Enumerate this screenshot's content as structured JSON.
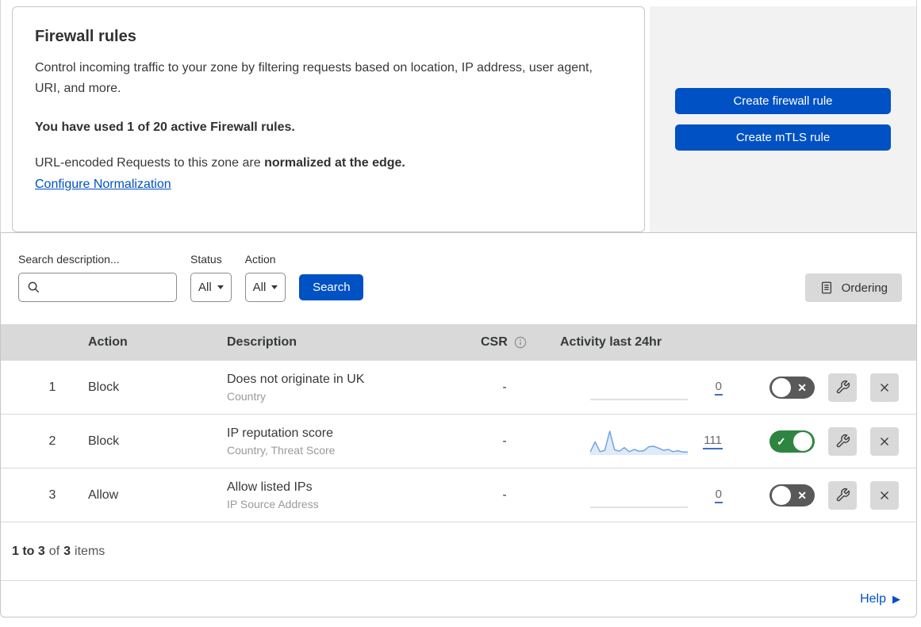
{
  "colors": {
    "primary_blue": "#0051c3",
    "toggle_on_green": "#2e8540",
    "toggle_off_gray": "#595959",
    "table_header_gray": "#d9d9d9",
    "panel_gray": "#f2f2f2",
    "sparkline_blue": "#74a3e3"
  },
  "icons": {
    "check": "✓",
    "cross": "✕",
    "help_arrow": "▶"
  },
  "overview": {
    "title": "Firewall rules",
    "description": "Control incoming traffic to your zone by filtering requests based on location, IP address, user agent, URI, and more.",
    "usage": "You have used 1 of 20 active Firewall rules.",
    "normalization_text": "URL-encoded Requests to this zone are",
    "normalization_bold": "normalized at the edge.",
    "normalization_link": "Configure Normalization"
  },
  "actions": {
    "create_firewall_rule": "Create firewall rule",
    "create_mtls_rule": "Create mTLS rule"
  },
  "filters": {
    "search_label": "Search description...",
    "status_label": "Status",
    "status_value": "All",
    "action_label": "Action",
    "action_value": "All",
    "search_button": "Search",
    "ordering_button": "Ordering"
  },
  "table": {
    "headers": {
      "action": "Action",
      "description": "Description",
      "csr": "CSR",
      "activity": "Activity last 24hr"
    },
    "rows": [
      {
        "priority": "1",
        "action": "Block",
        "description": "Does not originate in UK",
        "fields": "Country",
        "csr": "-",
        "activity_count": "0",
        "enabled": false
      },
      {
        "priority": "2",
        "action": "Block",
        "description": "IP reputation score",
        "fields": "Country, Threat Score",
        "csr": "-",
        "activity_count": "111",
        "enabled": true
      },
      {
        "priority": "3",
        "action": "Allow",
        "description": "Allow listed IPs",
        "fields": "IP Source Address",
        "csr": "-",
        "activity_count": "0",
        "enabled": false
      }
    ]
  },
  "footer": {
    "range": "1 to 3",
    "of": "of",
    "total": "3",
    "items": "items",
    "help": "Help"
  },
  "chart_data": {
    "type": "area",
    "title": "Activity last 24hr",
    "legend_position": "none",
    "axes_visible": false,
    "series": [
      {
        "name": "rule-1-activity",
        "total": 0,
        "values": [
          0,
          0
        ]
      },
      {
        "name": "rule-2-activity",
        "total": 111,
        "values": [
          6,
          52,
          8,
          14,
          100,
          16,
          10,
          26,
          8,
          18,
          10,
          12,
          30,
          32,
          24,
          14,
          18,
          8,
          12,
          6,
          6
        ]
      },
      {
        "name": "rule-3-activity",
        "total": 0,
        "values": [
          0,
          0
        ]
      }
    ]
  }
}
